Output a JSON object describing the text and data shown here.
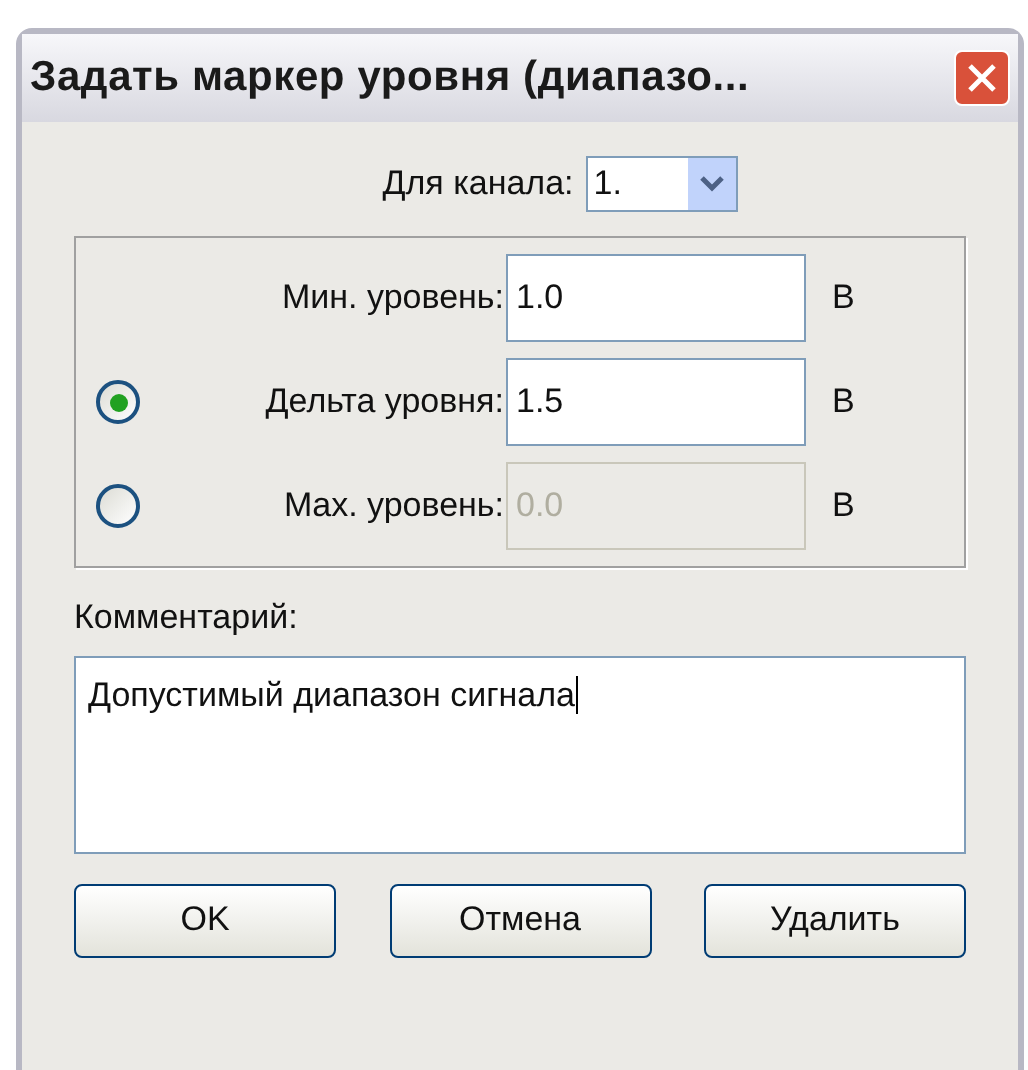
{
  "window": {
    "title": "Задать маркер уровня (диапазо..."
  },
  "channel": {
    "label": "Для канала:",
    "value": "1."
  },
  "levels": [
    {
      "kind": "plain",
      "label": "Мин. уровень:",
      "value": "1.0",
      "disabled": false,
      "unit": "В"
    },
    {
      "kind": "radio",
      "selected": true,
      "label": "Дельта уровня:",
      "value": "1.5",
      "disabled": false,
      "unit": "В"
    },
    {
      "kind": "radio",
      "selected": false,
      "label": "Max. уровень:",
      "value": "0.0",
      "disabled": true,
      "unit": "В"
    }
  ],
  "comment": {
    "label": "Комментарий:",
    "value": "Допустимый диапазон сигнала"
  },
  "buttons": [
    "OK",
    "Отмена",
    "Удалить"
  ]
}
